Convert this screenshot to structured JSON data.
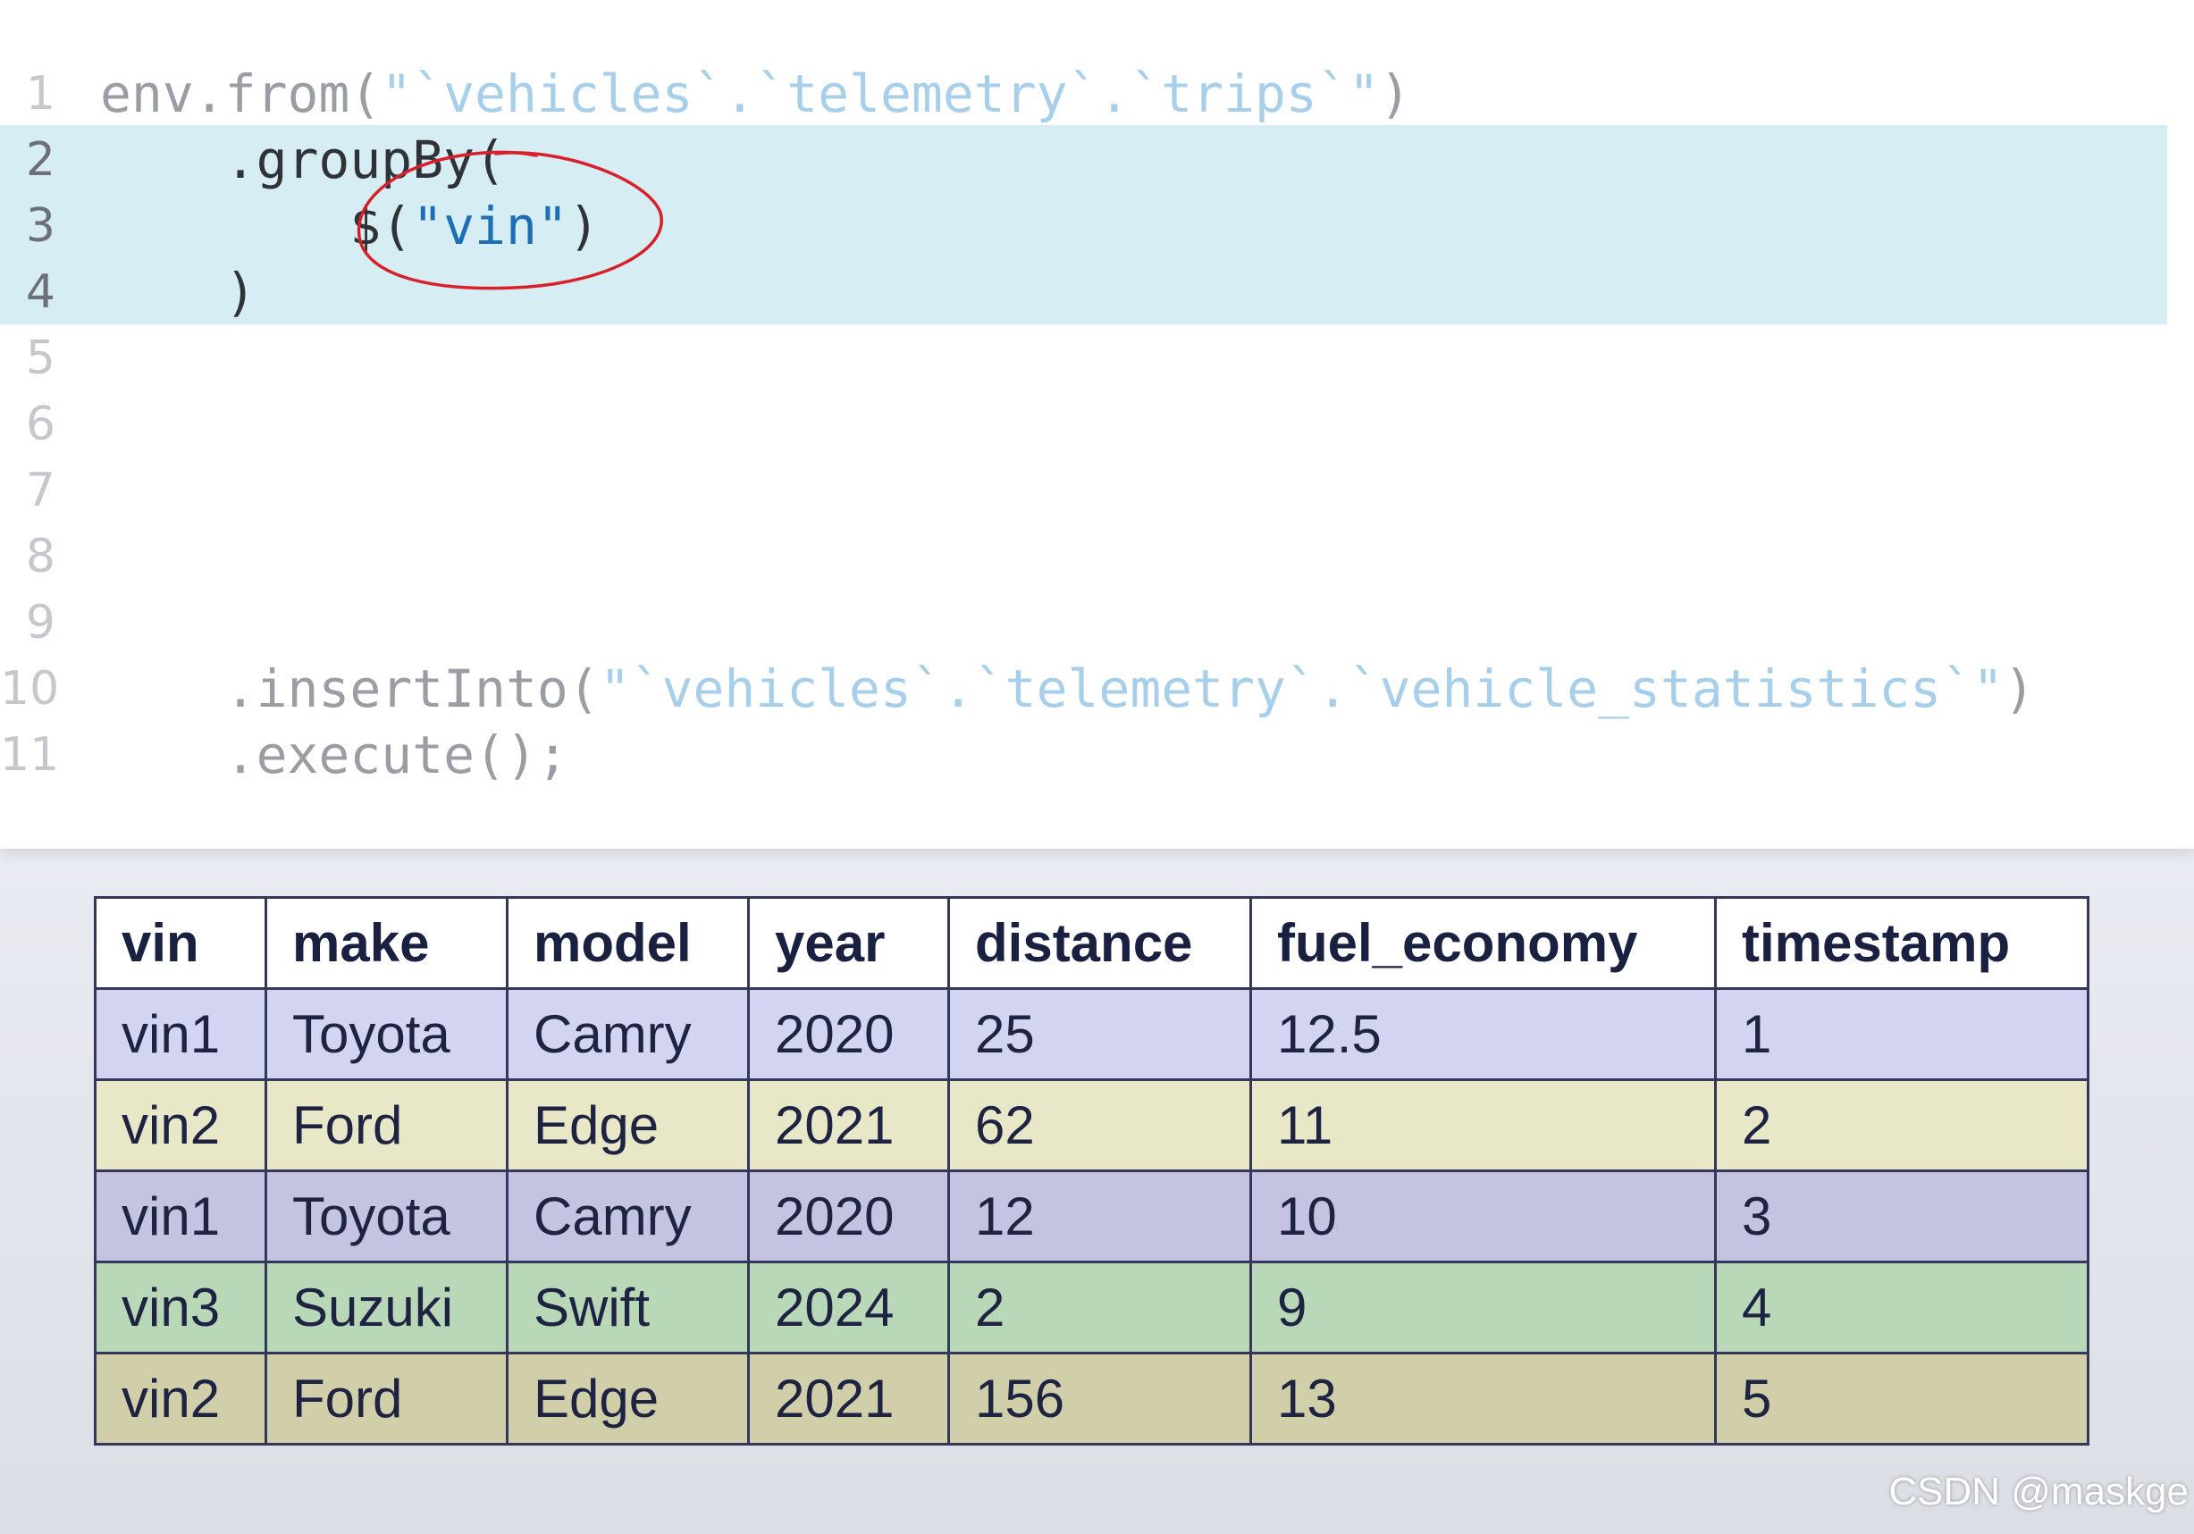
{
  "code": {
    "lines": [
      {
        "number": "1",
        "parts": [
          {
            "t": "env.from(",
            "s": false
          },
          {
            "t": "\"`vehicles`.`telemetry`.`trips`\"",
            "s": true
          },
          {
            "t": ")",
            "s": false
          }
        ]
      },
      {
        "number": "2",
        "parts": [
          {
            "t": "    .groupBy(",
            "s": false
          }
        ]
      },
      {
        "number": "3",
        "parts": [
          {
            "t": "        $(",
            "s": false
          },
          {
            "t": "\"vin\"",
            "s": true
          },
          {
            "t": ")",
            "s": false
          }
        ]
      },
      {
        "number": "4",
        "parts": [
          {
            "t": "    )",
            "s": false
          }
        ]
      },
      {
        "number": "5",
        "parts": []
      },
      {
        "number": "6",
        "parts": []
      },
      {
        "number": "7",
        "parts": []
      },
      {
        "number": "8",
        "parts": []
      },
      {
        "number": "9",
        "parts": []
      },
      {
        "number": "10",
        "parts": [
          {
            "t": "    .insertInto(",
            "s": false
          },
          {
            "t": "\"`vehicles`.`telemetry`.`vehicle_statistics`\"",
            "s": true
          },
          {
            "t": ")",
            "s": false
          }
        ]
      },
      {
        "number": "11",
        "parts": [
          {
            "t": "    .execute();",
            "s": false
          }
        ]
      }
    ],
    "highlighted_lines": [
      "2",
      "3",
      "4"
    ]
  },
  "table": {
    "headers": [
      "vin",
      "make",
      "model",
      "year",
      "distance",
      "fuel_economy",
      "timestamp"
    ],
    "rows": [
      [
        "vin1",
        "Toyota",
        "Camry",
        "2020",
        "25",
        "12.5",
        "1"
      ],
      [
        "vin2",
        "Ford",
        "Edge",
        "2021",
        "62",
        "11",
        "2"
      ],
      [
        "vin1",
        "Toyota",
        "Camry",
        "2020",
        "12",
        "10",
        "3"
      ],
      [
        "vin3",
        "Suzuki",
        "Swift",
        "2024",
        "2",
        "9",
        "4"
      ],
      [
        "vin2",
        "Ford",
        "Edge",
        "2021",
        "156",
        "13",
        "5"
      ]
    ]
  },
  "colors": {
    "highlight": "#d6edf3",
    "annotation": "#d8202a",
    "string_active": "#1c6fb5",
    "string_muted": "#a7cfe9"
  },
  "watermark": "CSDN @maskge"
}
